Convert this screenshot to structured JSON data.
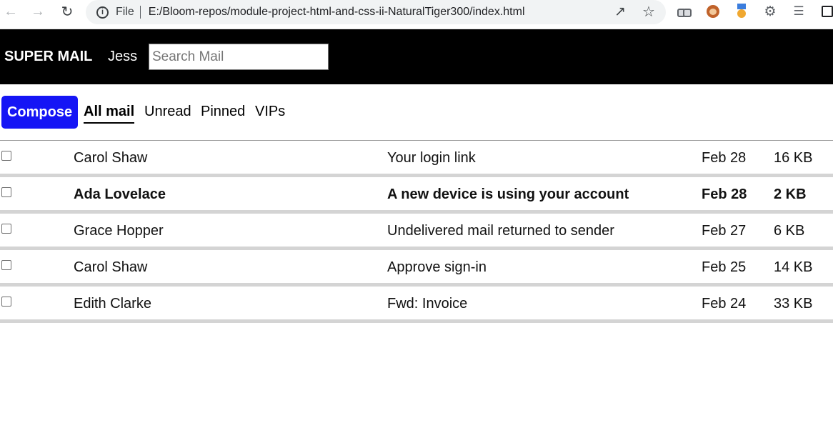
{
  "browser": {
    "scheme_label": "File",
    "url": "E:/Bloom-repos/module-project-html-and-css-ii-NaturalTiger300/index.html",
    "icons": [
      "back-icon",
      "forward-icon",
      "reload-icon",
      "info-icon",
      "share-icon",
      "star-icon",
      "glasses-extension-icon",
      "monkey-extension-icon",
      "medal-extension-icon",
      "puzzle-icon",
      "media-control-icon",
      "window-icon"
    ]
  },
  "header": {
    "brand": "SUPER MAIL",
    "user": "Jess",
    "search_placeholder": "Search Mail",
    "background_color": "#000000"
  },
  "toolbar": {
    "compose_label": "Compose",
    "compose_color": "#1515f5",
    "tabs": [
      {
        "label": "All mail",
        "active": true
      },
      {
        "label": "Unread",
        "active": false
      },
      {
        "label": "Pinned",
        "active": false
      },
      {
        "label": "VIPs",
        "active": false
      }
    ]
  },
  "mails": [
    {
      "from": "Carol Shaw",
      "subject": "Your login link",
      "date": "Feb 28",
      "size": "16 KB",
      "unread": false,
      "checked": false
    },
    {
      "from": "Ada Lovelace",
      "subject": "A new device is using your account",
      "date": "Feb 28",
      "size": "2 KB",
      "unread": true,
      "checked": false
    },
    {
      "from": "Grace Hopper",
      "subject": "Undelivered mail returned to sender",
      "date": "Feb 27",
      "size": "6 KB",
      "unread": false,
      "checked": false
    },
    {
      "from": "Carol Shaw",
      "subject": "Approve sign-in",
      "date": "Feb 25",
      "size": "14 KB",
      "unread": false,
      "checked": false
    },
    {
      "from": "Edith Clarke",
      "subject": "Fwd: Invoice",
      "date": "Feb 24",
      "size": "33 KB",
      "unread": false,
      "checked": false
    }
  ]
}
